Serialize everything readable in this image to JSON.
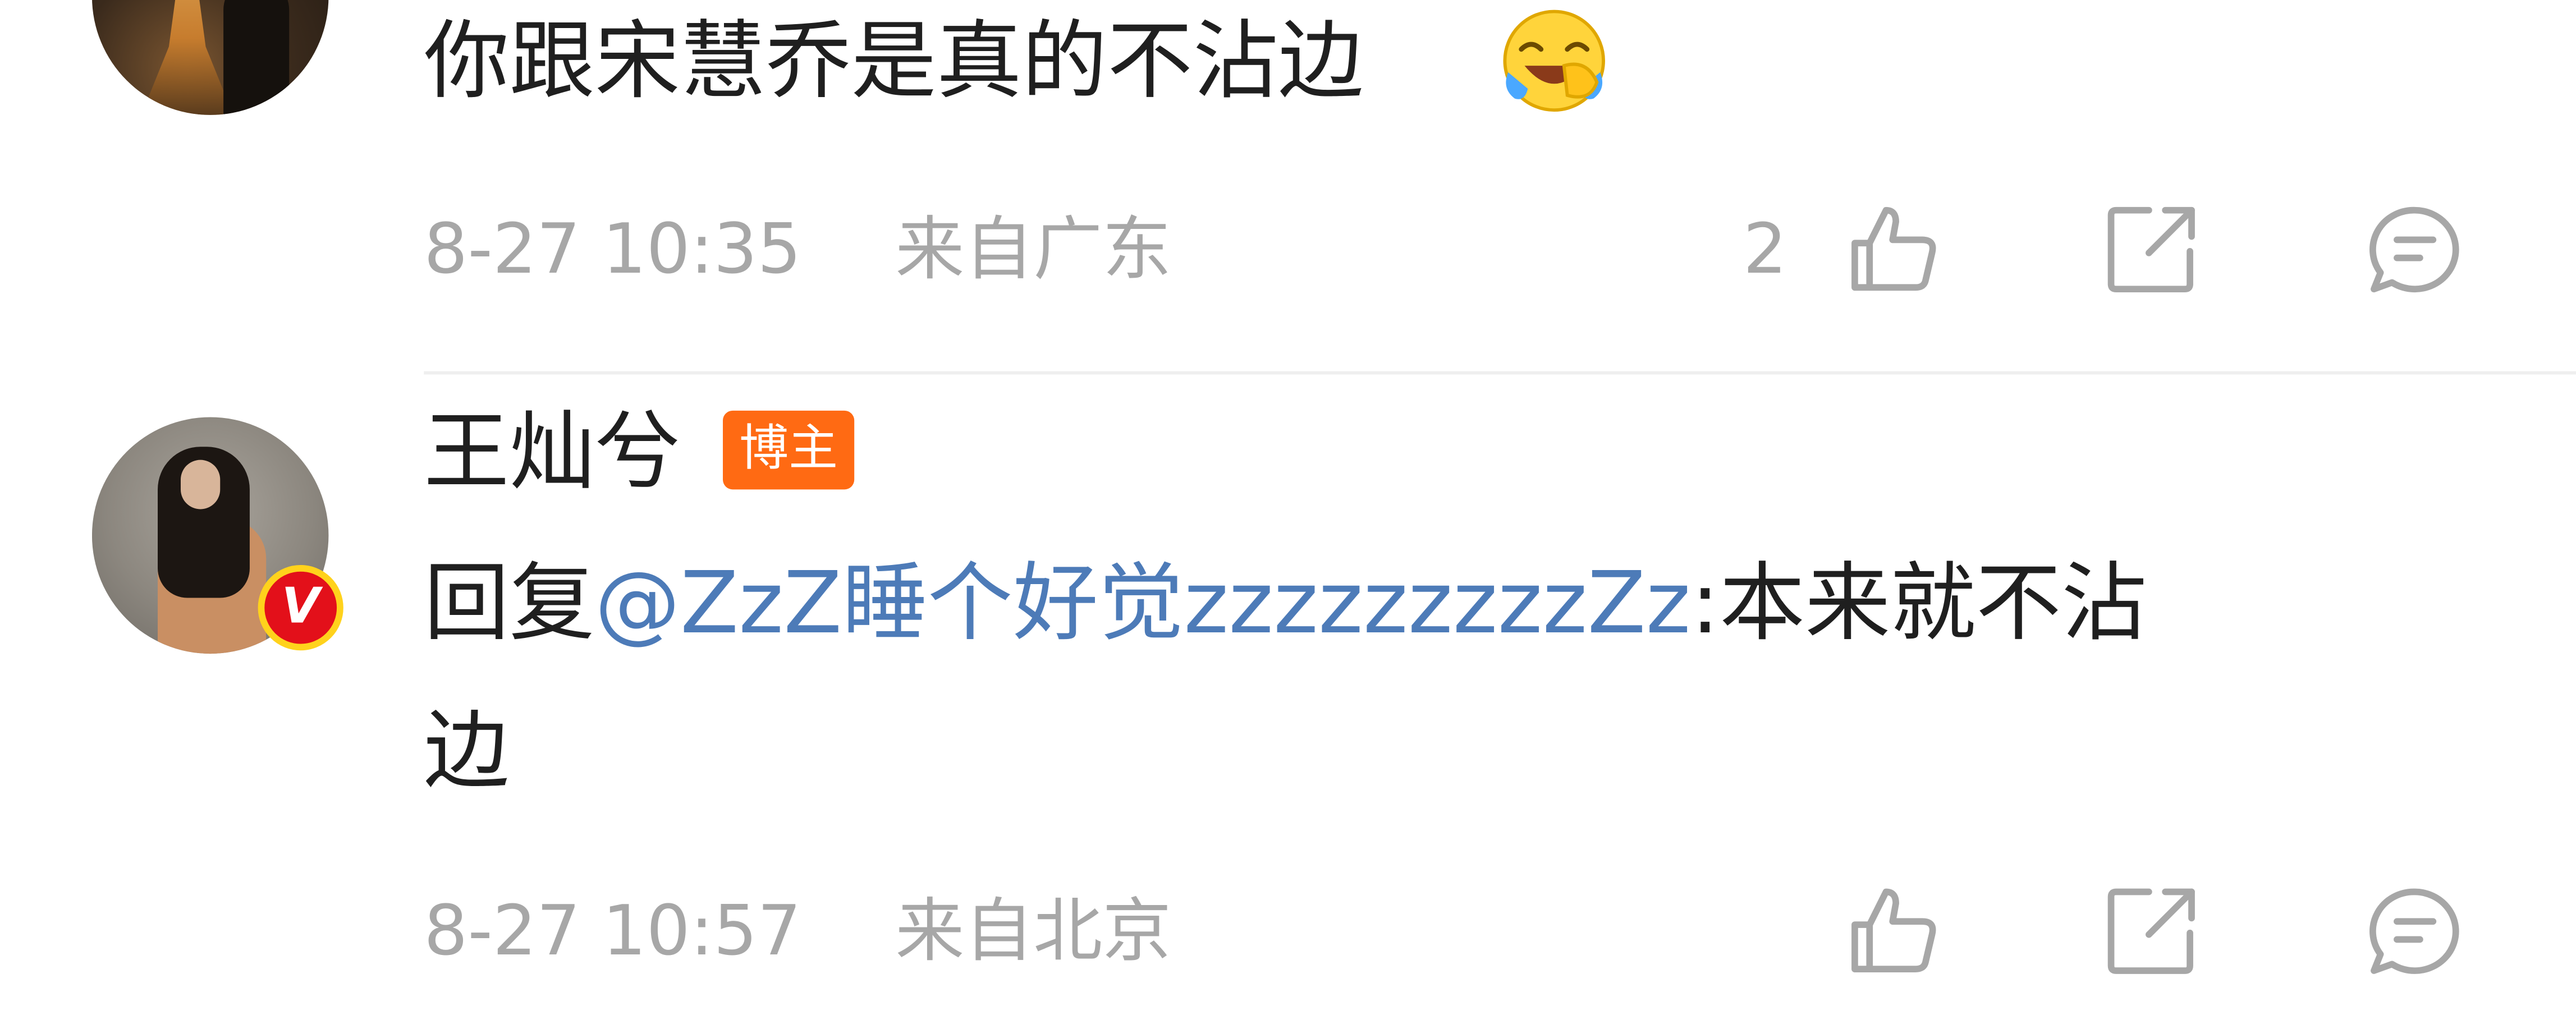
{
  "comment1": {
    "text": "你跟宋慧乔是真的不沾边",
    "emoji": "laughing-crying-emoji",
    "date": "8-27 10:35",
    "location": "来自广东",
    "like_count": "2"
  },
  "comment2": {
    "username": "王灿兮",
    "tag": "博主",
    "verified_badge": "V",
    "reply_prefix": "回复",
    "mention": "@ZzZ睡个好觉zzzzzzzzzZz",
    "separator": ":",
    "text_line1": "本来就不沾",
    "text_line2": "边",
    "date": "8-27 10:57",
    "location": "来自北京"
  },
  "icons": [
    "like-icon",
    "repost-icon",
    "comment-icon"
  ],
  "colors": {
    "mention": "#4d7bb8",
    "meta": "#a7a7a7",
    "tag_bg": "#ff6a13",
    "verified_badge": "#e3101a"
  }
}
